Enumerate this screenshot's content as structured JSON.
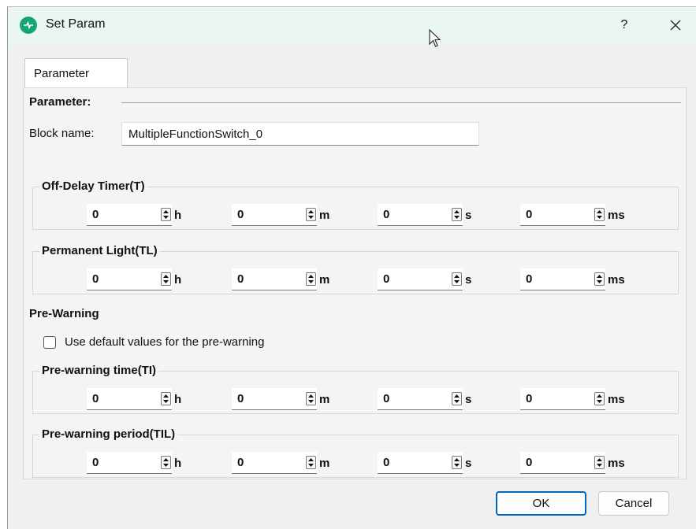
{
  "window": {
    "title": "Set Param",
    "help_label": "?",
    "close_icon": "close-icon",
    "app_icon": "app-logo-icon"
  },
  "tabs": [
    {
      "label": "Parameter",
      "selected": true
    }
  ],
  "parameter_section": {
    "title": "Parameter:",
    "block_name_label": "Block name:",
    "block_name_value": "MultipleFunctionSwitch_0"
  },
  "groups": [
    {
      "title": "Off-Delay Timer(T)",
      "values": {
        "h": "0",
        "m": "0",
        "s": "0",
        "ms": "0"
      }
    },
    {
      "title": "Permanent Light(TL)",
      "values": {
        "h": "0",
        "m": "0",
        "s": "0",
        "ms": "0"
      }
    }
  ],
  "pre_warning": {
    "title": "Pre-Warning",
    "checkbox_label": "Use default values for the pre-warning",
    "checkbox_checked": false,
    "groups": [
      {
        "title": "Pre-warning time(TI)",
        "values": {
          "h": "0",
          "m": "0",
          "s": "0",
          "ms": "0"
        }
      },
      {
        "title": "Pre-warning period(TIL)",
        "values": {
          "h": "0",
          "m": "0",
          "s": "0",
          "ms": "0"
        }
      }
    ]
  },
  "units": {
    "h": "h",
    "m": "m",
    "s": "s",
    "ms": "ms"
  },
  "buttons": {
    "ok": "OK",
    "cancel": "Cancel"
  },
  "colors": {
    "titlebar": "#e9f6f3",
    "accent": "#0067c0",
    "app_icon": "#17a673"
  }
}
